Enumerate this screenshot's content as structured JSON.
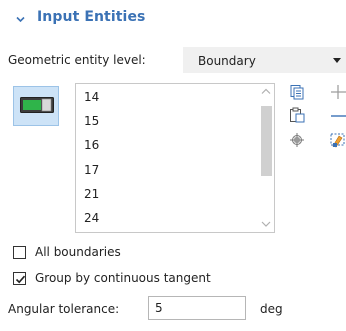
{
  "section": {
    "title": "Input Entities",
    "expanded": true
  },
  "entity_level": {
    "label": "Geometric entity level:",
    "value": "Boundary"
  },
  "selection_list": {
    "items": [
      "14",
      "15",
      "16",
      "17",
      "21",
      "24"
    ]
  },
  "toolbar": {
    "icons": [
      "copy-list-icon",
      "paste-icon",
      "zoom-to-selection-icon",
      "add-icon",
      "remove-icon",
      "clear-selection-icon"
    ]
  },
  "checkboxes": {
    "all_boundaries": {
      "label": "All boundaries",
      "checked": false
    },
    "group_by_tangent": {
      "label": "Group by continuous tangent",
      "checked": true
    }
  },
  "angular_tolerance": {
    "label": "Angular tolerance:",
    "value": "5",
    "unit": "deg"
  },
  "colors": {
    "accent": "#3b72b5",
    "active_toggle_bg": "#cde3f7",
    "active_toggle_green": "#2fb44a"
  }
}
